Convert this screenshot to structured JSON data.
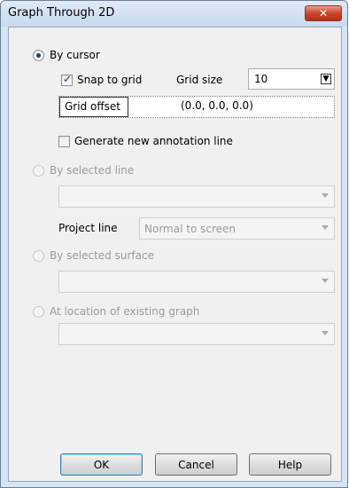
{
  "window": {
    "title": "Graph Through 2D",
    "close_icon": "close-icon"
  },
  "by_cursor": {
    "label": "By cursor",
    "snap_label": "Snap to grid",
    "grid_size_label": "Grid size",
    "grid_size_value": "10",
    "grid_offset_label": "Grid offset",
    "grid_offset_value": "(0.0, 0.0, 0.0)",
    "generate_label": "Generate new annotation line"
  },
  "by_selected_line": {
    "label": "By selected line",
    "selection_value": "",
    "project_line_label": "Project line",
    "project_line_value": "Normal to screen"
  },
  "by_selected_surface": {
    "label": "By selected surface",
    "selection_value": ""
  },
  "existing_graph": {
    "label": "At location of existing graph",
    "selection_value": ""
  },
  "buttons": {
    "ok": "OK",
    "cancel": "Cancel",
    "help": "Help"
  },
  "colors": {
    "frame": "#d6e4f3",
    "client": "#f0f0f0",
    "close": "#c9462a"
  }
}
